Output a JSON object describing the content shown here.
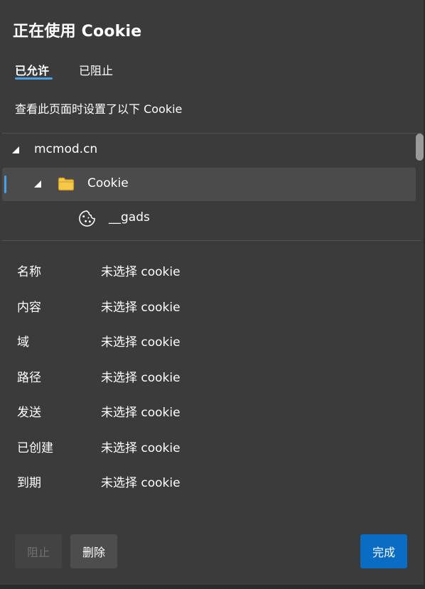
{
  "dialog": {
    "title": "正在使用 Cookie",
    "tabs": [
      {
        "label": "已允许",
        "active": true
      },
      {
        "label": "已阻止",
        "active": false
      }
    ],
    "description": "查看此页面时设置了以下 Cookie"
  },
  "tree": {
    "domain": {
      "label": "mcmod.cn",
      "expanded": true
    },
    "folder": {
      "label": "Cookie",
      "expanded": true,
      "selected": true,
      "icon": "folder-icon"
    },
    "cookie": {
      "label": "__gads",
      "icon": "cookie-icon"
    }
  },
  "details": [
    {
      "key": "名称",
      "value": "未选择 cookie"
    },
    {
      "key": "内容",
      "value": "未选择 cookie"
    },
    {
      "key": "域",
      "value": "未选择 cookie"
    },
    {
      "key": "路径",
      "value": "未选择 cookie"
    },
    {
      "key": "发送",
      "value": "未选择 cookie"
    },
    {
      "key": "已创建",
      "value": "未选择 cookie"
    },
    {
      "key": "到期",
      "value": "未选择 cookie"
    }
  ],
  "buttons": {
    "block": {
      "label": "阻止",
      "enabled": false
    },
    "delete": {
      "label": "删除",
      "enabled": true
    },
    "done": {
      "label": "完成",
      "enabled": true
    }
  },
  "colors": {
    "background": "#3b3b3b",
    "accent": "#4aa0e0",
    "primary_button": "#0a6cc2",
    "folder": "#f5c84c"
  }
}
